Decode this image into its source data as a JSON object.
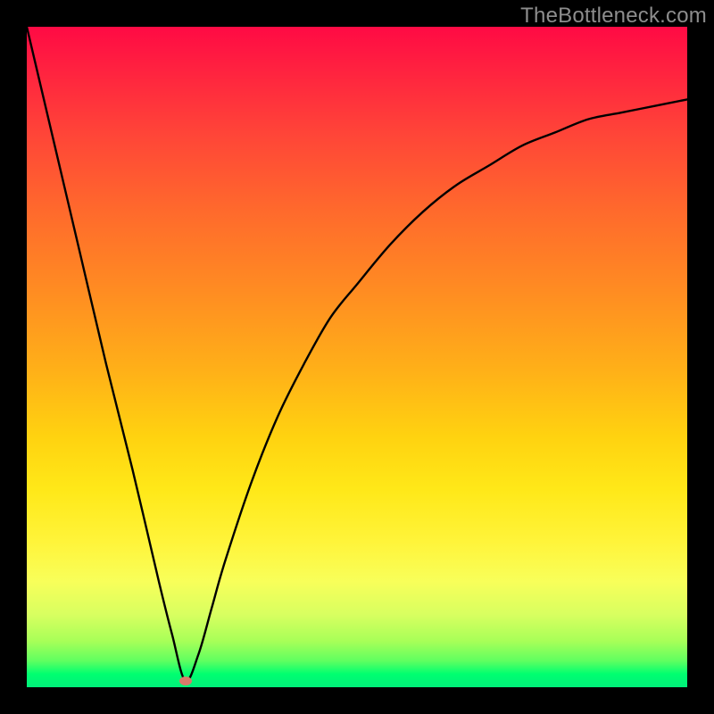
{
  "watermark": "TheBottleneck.com",
  "colors": {
    "frame": "#000000",
    "gradient_top": "#ff0a44",
    "gradient_bottom": "#00ef7a",
    "curve": "#000000",
    "marker": "#d87a6a",
    "watermark_text": "#8d8d8d"
  },
  "chart_data": {
    "type": "line",
    "title": "",
    "xlabel": "",
    "ylabel": "",
    "xlim": [
      0,
      100
    ],
    "ylim": [
      0,
      100
    ],
    "grid": false,
    "legend": false,
    "notes": "Single black curve on a vertical heat gradient. Curve descends steeply from the top-left border, reaches a minimum near x≈24 (touching the bottom green band), then rises asymptotically toward ~y≈89 at the right edge. A small rounded marker sits at the minimum.",
    "series": [
      {
        "name": "curve",
        "x": [
          0,
          4,
          8,
          12,
          16,
          20,
          22,
          24,
          26,
          28,
          30,
          34,
          38,
          42,
          46,
          50,
          55,
          60,
          65,
          70,
          75,
          80,
          85,
          90,
          95,
          100
        ],
        "y": [
          100,
          83,
          66,
          49,
          33,
          16,
          8,
          1,
          5,
          12,
          19,
          31,
          41,
          49,
          56,
          61,
          67,
          72,
          76,
          79,
          82,
          84,
          86,
          87,
          88,
          89
        ]
      }
    ],
    "marker": {
      "x": 24,
      "y": 1
    }
  }
}
